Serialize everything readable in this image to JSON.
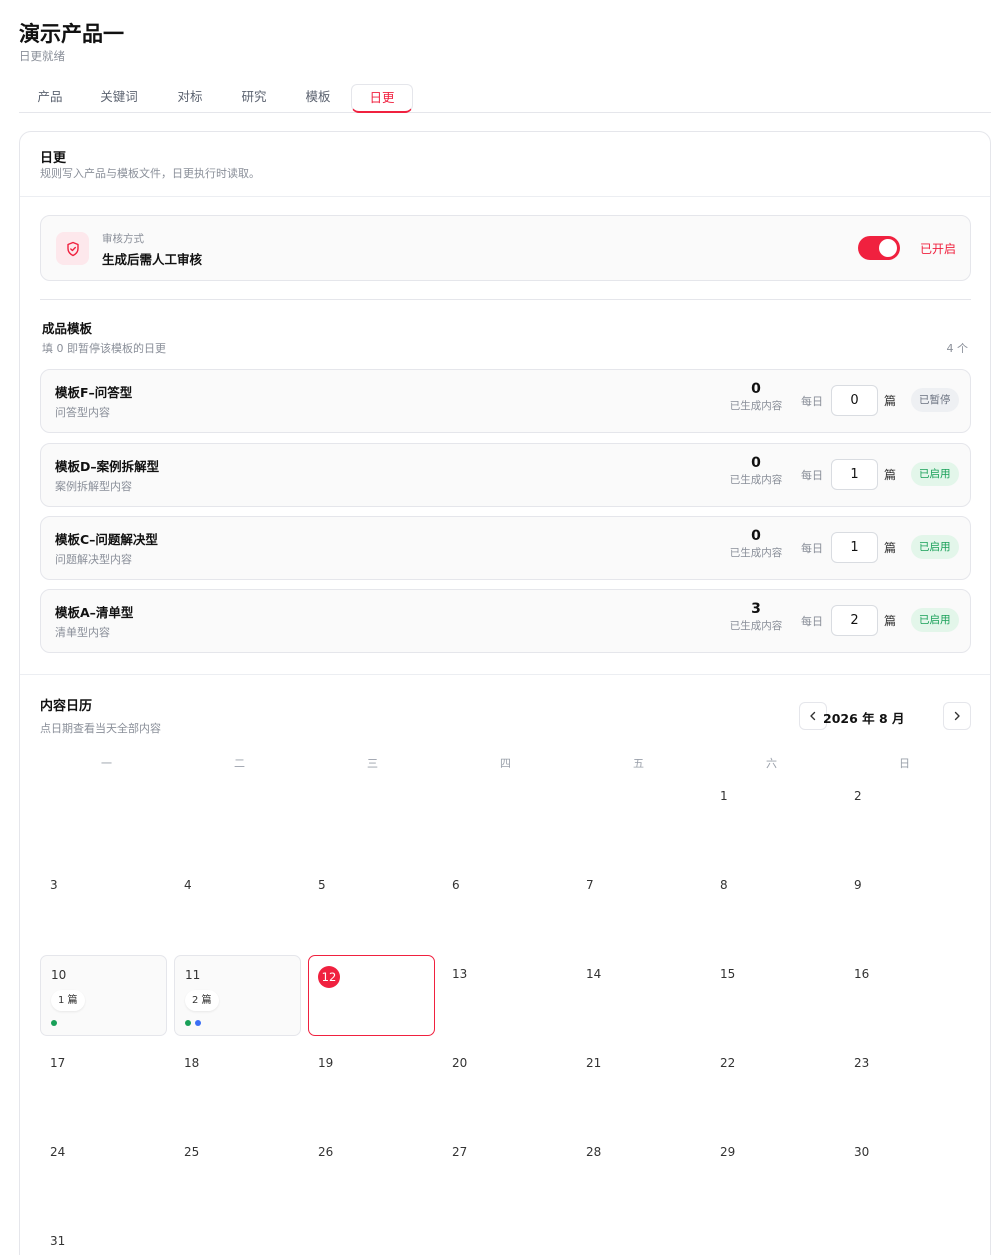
{
  "page": {
    "title": "演示产品一",
    "subtitle": "日更就绪"
  },
  "tabs": [
    "产品",
    "关键词",
    "对标",
    "研究",
    "模板",
    "日更"
  ],
  "active_tab": "日更",
  "section": {
    "title": "日更",
    "description": "规则写入产品与模板文件，日更执行时读取。"
  },
  "review": {
    "label": "审核方式",
    "value": "生成后需人工审核",
    "enabled": true,
    "status": "已开启"
  },
  "templates": {
    "title": "成品模板",
    "hint": "填 0 即暂停该模板的日更",
    "count": "4 个",
    "generated_label": "已生成内容",
    "daily_label": "每日",
    "unit": "篇",
    "items": [
      {
        "name": "模板F–问答型",
        "subtitle": "问答型内容",
        "generated": "0",
        "daily": "0",
        "status": "已暂停"
      },
      {
        "name": "模板D–案例拆解型",
        "subtitle": "案例拆解型内容",
        "generated": "0",
        "daily": "1",
        "status": "已启用"
      },
      {
        "name": "模板C–问题解决型",
        "subtitle": "问题解决型内容",
        "generated": "0",
        "daily": "1",
        "status": "已启用"
      },
      {
        "name": "模板A–清单型",
        "subtitle": "清单型内容",
        "generated": "3",
        "daily": "2",
        "status": "已启用"
      }
    ]
  },
  "calendar": {
    "title": "内容日历",
    "description": "点日期查看当天全部内容",
    "month_label": "2026 年 8 月",
    "weekdays": [
      "一",
      "二",
      "三",
      "四",
      "五",
      "六",
      "日"
    ],
    "today": "12",
    "colors": {
      "accent": "#f0213f",
      "green": "#18a058",
      "blue": "#3b6ff5"
    },
    "content_days": [
      {
        "day": "10",
        "count": "1 篇",
        "dots": [
          "#18a058"
        ]
      },
      {
        "day": "11",
        "count": "2 篇",
        "dots": [
          "#18a058",
          "#3b6ff5"
        ]
      }
    ],
    "days": [
      "1",
      "2",
      "3",
      "4",
      "5",
      "6",
      "7",
      "8",
      "9",
      "10",
      "11",
      "12",
      "13",
      "14",
      "15",
      "16",
      "17",
      "18",
      "19",
      "20",
      "21",
      "22",
      "23",
      "24",
      "25",
      "26",
      "27",
      "28",
      "29",
      "30",
      "31"
    ]
  }
}
